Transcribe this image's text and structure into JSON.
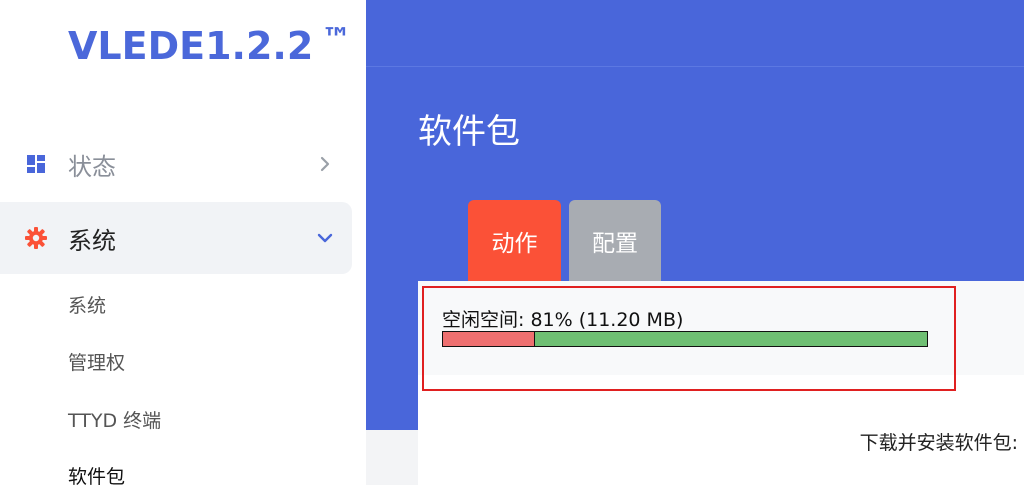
{
  "logo": {
    "text": "VLEDE1.2.2",
    "tm": "™"
  },
  "sidebar": {
    "status_label": "状态",
    "system_label": "系统",
    "subitems": [
      "系统",
      "管理权",
      "TTYD 终端",
      "软件包"
    ]
  },
  "main": {
    "page_title": "软件包",
    "tabs": [
      "动作",
      "配置"
    ],
    "free_space_label": "空闲空间: 81% (11.20 MB)",
    "free_space_percent": 81,
    "used_space_percent": 19,
    "install_label": "下载并安装软件包:"
  },
  "colors": {
    "accent": "#4966da",
    "tab_active": "#fb5137",
    "tab_inactive": "#a8acb2",
    "used_bar": "#ee7070",
    "free_bar": "#6fbf73",
    "highlight": "#e02020"
  },
  "icons": {
    "status": "dashboard-icon",
    "system": "gear-icon",
    "collapsed": "chevron-right-icon",
    "expanded": "chevron-down-icon"
  }
}
